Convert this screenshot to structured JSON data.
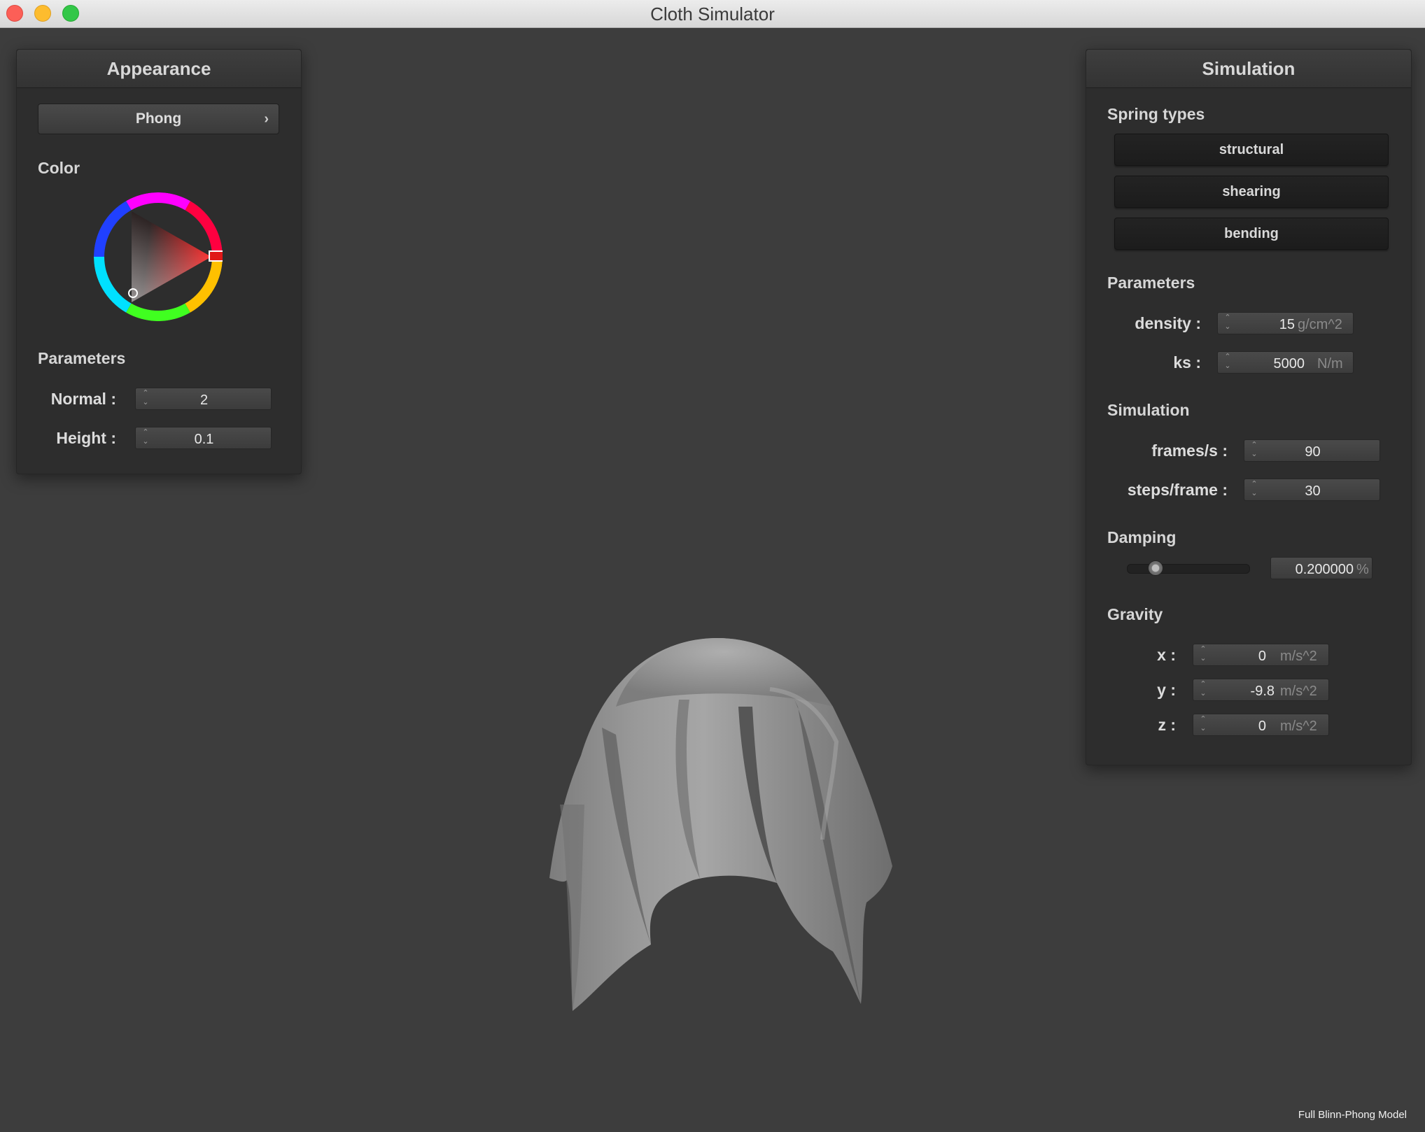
{
  "window": {
    "title": "Cloth Simulator"
  },
  "appearance": {
    "header": "Appearance",
    "shader_label": "Phong",
    "color_label": "Color",
    "selected_color": "#e01818",
    "parameters_label": "Parameters",
    "normal_label": "Normal :",
    "normal_value": "2",
    "height_label": "Height :",
    "height_value": "0.1"
  },
  "simulation": {
    "header": "Simulation",
    "spring_types_label": "Spring types",
    "springs": [
      "structural",
      "shearing",
      "bending"
    ],
    "parameters_label": "Parameters",
    "density_label": "density :",
    "density_value": "15",
    "density_unit": "g/cm^2",
    "ks_label": "ks :",
    "ks_value": "5000",
    "ks_unit": "N/m",
    "sim_label": "Simulation",
    "fps_label": "frames/s :",
    "fps_value": "90",
    "steps_label": "steps/frame :",
    "steps_value": "30",
    "damping_label": "Damping",
    "damping_value": "0.200000",
    "damping_unit": "%",
    "damping_fraction": 0.2,
    "gravity_label": "Gravity",
    "gx_label": "x :",
    "gx_value": "0",
    "gy_label": "y :",
    "gy_value": "-9.8",
    "gz_label": "z :",
    "gz_value": "0",
    "gravity_unit": "m/s^2"
  },
  "status": "Full Blinn-Phong Model",
  "icons": {
    "close": "close-light",
    "minimize": "minimize-light",
    "maximize": "maximize-light",
    "chevron": "chevron-right-icon",
    "spin": "spin-arrows-icon"
  }
}
